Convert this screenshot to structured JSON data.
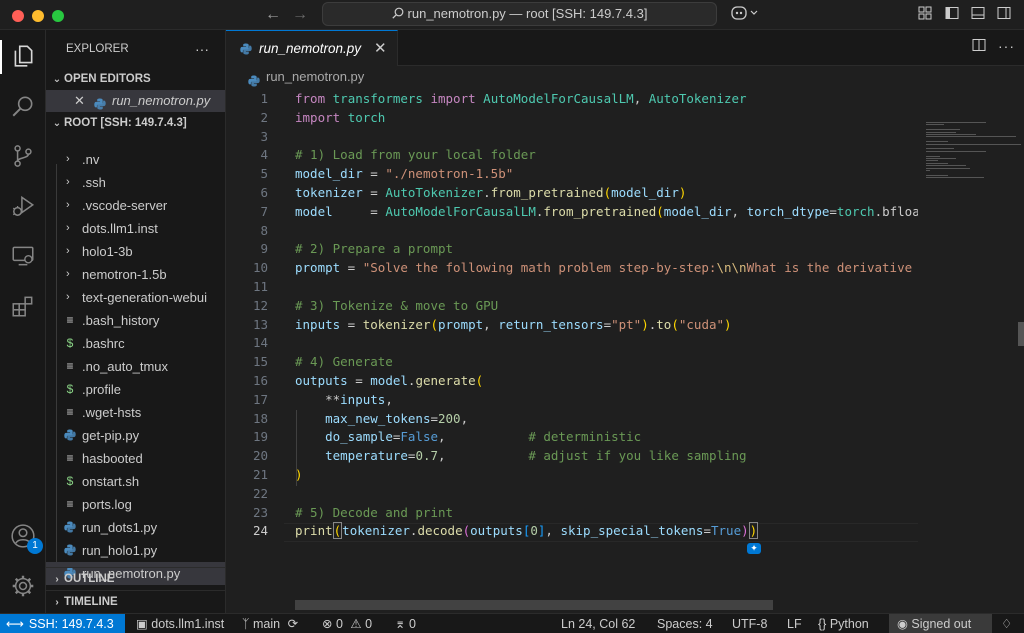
{
  "titlebar": {
    "command_center": "run_nemotron.py — root [SSH: 149.7.4.3]",
    "back_icon": "arrow-left-icon",
    "forward_icon": "arrow-right-icon"
  },
  "activity_bar": {
    "items": [
      "explorer-icon",
      "search-icon",
      "source-control-icon",
      "run-debug-icon",
      "remote-explorer-icon",
      "extensions-icon"
    ],
    "accounts_badge": "1"
  },
  "explorer": {
    "title": "EXPLORER",
    "more": "···",
    "open_editors_label": "OPEN EDITORS",
    "open_editor_file": "run_nemotron.py",
    "root_label": "ROOT [SSH: 149.7.4.3]",
    "items": [
      {
        "label": ".nv",
        "type": "folder"
      },
      {
        "label": ".ssh",
        "type": "folder"
      },
      {
        "label": ".vscode-server",
        "type": "folder"
      },
      {
        "label": "dots.llm1.inst",
        "type": "folder"
      },
      {
        "label": "holo1-3b",
        "type": "folder"
      },
      {
        "label": "nemotron-1.5b",
        "type": "folder"
      },
      {
        "label": "text-generation-webui",
        "type": "folder"
      },
      {
        "label": ".bash_history",
        "type": "text"
      },
      {
        "label": ".bashrc",
        "type": "shell"
      },
      {
        "label": ".no_auto_tmux",
        "type": "text"
      },
      {
        "label": ".profile",
        "type": "shell"
      },
      {
        "label": ".wget-hsts",
        "type": "text"
      },
      {
        "label": "get-pip.py",
        "type": "python"
      },
      {
        "label": "hasbooted",
        "type": "text"
      },
      {
        "label": "onstart.sh",
        "type": "shell"
      },
      {
        "label": "ports.log",
        "type": "text"
      },
      {
        "label": "run_dots1.py",
        "type": "python"
      },
      {
        "label": "run_holo1.py",
        "type": "python"
      },
      {
        "label": "run_nemotron.py",
        "type": "python"
      }
    ],
    "outline_label": "OUTLINE",
    "timeline_label": "TIMELINE"
  },
  "editor": {
    "tab_label": "run_nemotron.py",
    "breadcrumb": "run_nemotron.py",
    "current_line": 24,
    "line_numbers": [
      "1",
      "2",
      "3",
      "4",
      "5",
      "6",
      "7",
      "8",
      "9",
      "10",
      "11",
      "12",
      "13",
      "14",
      "15",
      "16",
      "17",
      "18",
      "19",
      "20",
      "21",
      "22",
      "23",
      "24"
    ]
  },
  "statusbar": {
    "remote": "SSH: 149.7.4.3",
    "workspace": "dots.llm1.inst",
    "branch": "main",
    "errors": "0",
    "warnings": "0",
    "ports": "0",
    "cursor": "Ln 24, Col 62",
    "spaces": "Spaces: 4",
    "encoding": "UTF-8",
    "eol": "LF",
    "language": "Python",
    "account": "Signed out"
  }
}
